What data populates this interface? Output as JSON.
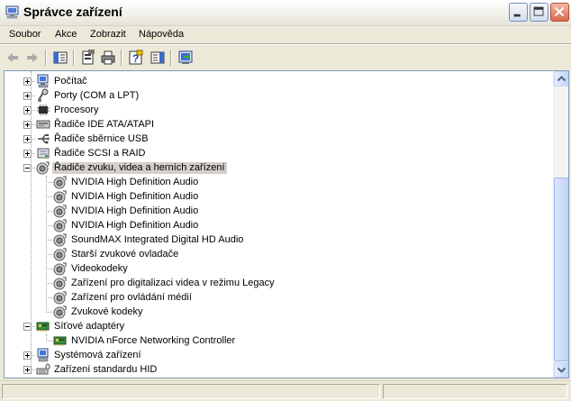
{
  "window": {
    "title": "Správce zařízení"
  },
  "menu": [
    {
      "label": "Soubor"
    },
    {
      "label": "Akce"
    },
    {
      "label": "Zobrazit"
    },
    {
      "label": "Nápověda"
    }
  ],
  "toolbar": {
    "buttons": [
      "back-icon",
      "forward-icon",
      "show-hide-console-tree-icon",
      "properties-icon",
      "print-icon",
      "help-icon",
      "show-hide-action-pane-icon",
      "update-driver-icon"
    ]
  },
  "tree": {
    "items": [
      {
        "label": "Počítač",
        "icon": "computer-icon",
        "level": 0,
        "expander": "plus"
      },
      {
        "label": "Porty (COM a LPT)",
        "icon": "port-icon",
        "level": 0,
        "expander": "plus"
      },
      {
        "label": "Procesory",
        "icon": "processor-icon",
        "level": 0,
        "expander": "plus"
      },
      {
        "label": "Řadiče IDE ATA/ATAPI",
        "icon": "ide-controller-icon",
        "level": 0,
        "expander": "plus"
      },
      {
        "label": "Řadiče sběrnice USB",
        "icon": "usb-icon",
        "level": 0,
        "expander": "plus"
      },
      {
        "label": "Řadiče SCSI a RAID",
        "icon": "scsi-icon",
        "level": 0,
        "expander": "plus"
      },
      {
        "label": "Řadiče zvuku, videa a herních zařízení",
        "icon": "sound-icon",
        "level": 0,
        "expander": "minus",
        "selected": true
      },
      {
        "label": "NVIDIA High Definition Audio",
        "icon": "sound-icon",
        "level": 1
      },
      {
        "label": "NVIDIA High Definition Audio",
        "icon": "sound-icon",
        "level": 1
      },
      {
        "label": "NVIDIA High Definition Audio",
        "icon": "sound-icon",
        "level": 1
      },
      {
        "label": "NVIDIA High Definition Audio",
        "icon": "sound-icon",
        "level": 1
      },
      {
        "label": "SoundMAX Integrated Digital HD Audio",
        "icon": "sound-icon",
        "level": 1
      },
      {
        "label": "Starší zvukové ovladače",
        "icon": "sound-icon",
        "level": 1
      },
      {
        "label": "Videokodeky",
        "icon": "sound-icon",
        "level": 1
      },
      {
        "label": "Zařízení pro digitalizaci videa v režimu Legacy",
        "icon": "sound-icon",
        "level": 1
      },
      {
        "label": "Zařízení pro ovládání médií",
        "icon": "sound-icon",
        "level": 1
      },
      {
        "label": "Zvukové kodeky",
        "icon": "sound-icon",
        "level": 1
      },
      {
        "label": "Síťové adaptéry",
        "icon": "network-adapter-icon",
        "level": 0,
        "expander": "minus"
      },
      {
        "label": "NVIDIA nForce Networking Controller",
        "icon": "network-adapter-icon",
        "level": 1
      },
      {
        "label": "Systémová zařízení",
        "icon": "system-devices-icon",
        "level": 0,
        "expander": "plus"
      },
      {
        "label": "Zařízení standardu HID",
        "icon": "hid-icon",
        "level": 0,
        "expander": "plus"
      }
    ]
  },
  "colors": {
    "chrome": "#ECE9D8",
    "border": "#7f9db9",
    "selection": "#d4d0c8"
  }
}
